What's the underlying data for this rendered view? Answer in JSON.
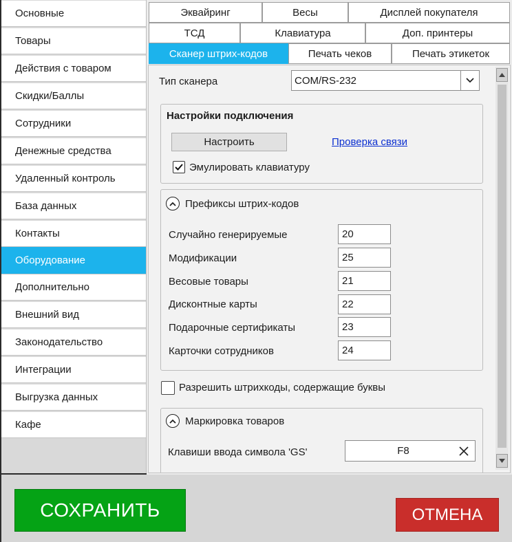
{
  "sidebar": {
    "items": [
      {
        "label": "Основные"
      },
      {
        "label": "Товары"
      },
      {
        "label": "Действия с товаром"
      },
      {
        "label": "Скидки/Баллы"
      },
      {
        "label": "Сотрудники"
      },
      {
        "label": "Денежные средства"
      },
      {
        "label": "Удаленный контроль"
      },
      {
        "label": "База данных"
      },
      {
        "label": "Контакты"
      },
      {
        "label": "Оборудование",
        "active": true
      },
      {
        "label": "Дополнительно"
      },
      {
        "label": "Внешний вид"
      },
      {
        "label": "Законодательство"
      },
      {
        "label": "Интеграции"
      },
      {
        "label": "Выгрузка данных"
      },
      {
        "label": "Кафе"
      }
    ]
  },
  "tabs": {
    "row1": [
      "Эквайринг",
      "Весы",
      "Дисплей покупателя"
    ],
    "row2": [
      "ТСД",
      "Клавиатура",
      "Доп. принтеры"
    ],
    "row3": [
      "Сканер штрих-кодов",
      "Печать чеков",
      "Печать этикеток"
    ],
    "active": "Сканер штрих-кодов"
  },
  "scanner": {
    "type_label": "Тип сканера",
    "type_value": "COM/RS-232"
  },
  "connection": {
    "title": "Настройки подключения",
    "configure_label": "Настроить",
    "check_link": "Проверка связи",
    "emulate_label": "Эмулировать  клавиатуру",
    "emulate_checked": true
  },
  "prefixes": {
    "title": "Префиксы штрих-кодов",
    "rows": [
      {
        "label": "Случайно генерируемые",
        "value": "20"
      },
      {
        "label": "Модификации",
        "value": "25"
      },
      {
        "label": "Весовые товары",
        "value": "21"
      },
      {
        "label": "Дисконтные карты",
        "value": "22"
      },
      {
        "label": "Подарочные сертификаты",
        "value": "23"
      },
      {
        "label": "Карточки сотрудников",
        "value": "24"
      }
    ]
  },
  "allow_letters": {
    "label": "Разрешить штрихкоды, содержащие буквы",
    "checked": false
  },
  "marking": {
    "title": "Маркировка товаров",
    "gs_label": "Клавиши ввода символа 'GS'",
    "gs_value": "F8"
  },
  "footer": {
    "save_label": "СОХРАНИТЬ",
    "cancel_label": "ОТМЕНА"
  },
  "colors": {
    "accent": "#1cb3ec",
    "save": "#05a315",
    "cancel": "#c92e2b",
    "link": "#0b2fd0"
  },
  "icons": {
    "dropdown": "chevron-down-icon",
    "checkmark": "checkmark-icon",
    "collapse": "chevron-up-circle-icon",
    "clear": "close-icon",
    "scroll_up": "triangle-up-icon",
    "scroll_down": "triangle-down-icon"
  }
}
